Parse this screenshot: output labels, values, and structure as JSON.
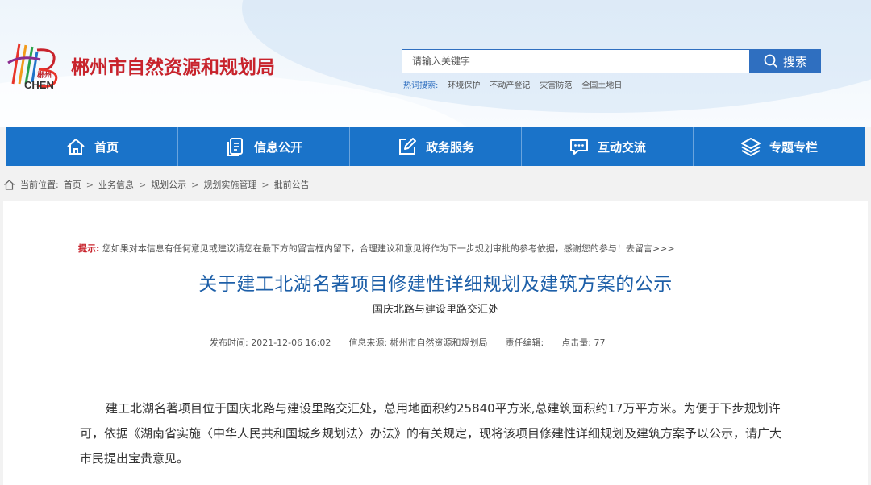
{
  "header": {
    "site_title": "郴州市自然资源和规划局",
    "logo_text_cn": "郴州",
    "logo_text_en": "CHEN",
    "search_placeholder": "请输入关键字",
    "search_button": "搜索",
    "hot_label": "热词搜索:",
    "hot_words": [
      "环境保护",
      "不动产登记",
      "灾害防范",
      "全国土地日"
    ]
  },
  "nav": {
    "items": [
      {
        "label": "首页",
        "icon": "home-icon"
      },
      {
        "label": "信息公开",
        "icon": "document-icon"
      },
      {
        "label": "政务服务",
        "icon": "edit-icon"
      },
      {
        "label": "互动交流",
        "icon": "chat-icon"
      },
      {
        "label": "专题专栏",
        "icon": "layers-icon"
      }
    ]
  },
  "breadcrumb": {
    "label": "当前位置:",
    "items": [
      "首页",
      "业务信息",
      "规划公示",
      "规划实施管理",
      "批前公告"
    ],
    "separator": ">"
  },
  "article": {
    "tip_label": "提示:",
    "tip_text": "您如果对本信息有任何意见或建议请您在最下方的留言框内留下，合理建议和意见将作为下一步规划审批的参考依据，感谢您的参与！去留言>>>",
    "title": "关于建工北湖名著项目修建性详细规划及建筑方案的公示",
    "subtitle": "国庆北路与建设里路交汇处",
    "meta": {
      "publish_label": "发布时间:",
      "publish_time": "2021-12-06 16:02",
      "source_label": "信息来源:",
      "source": "郴州市自然资源和规划局",
      "editor_label": "责任编辑:",
      "editor": "",
      "clicks_label": "点击量:",
      "clicks": "77"
    },
    "body": "建工北湖名著项目位于国庆北路与建设里路交汇处，总用地面积约25840平方米,总建筑面积约17万平方米。为便于下步规划许可，依据《湖南省实施〈中华人民共和国城乡规划法〉办法》的有关规定，现将该项目修建性详细规划及建筑方案予以公示，请广大市民提出宝贵意见。"
  },
  "colors": {
    "brand_red": "#c8232c",
    "nav_blue": "#1a73c9",
    "title_blue": "#1d5fa8"
  }
}
